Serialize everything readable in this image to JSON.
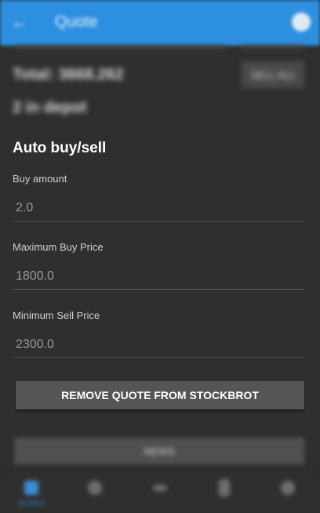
{
  "appbar": {
    "title": "Quote",
    "back_icon": "back-arrow-icon",
    "action_icon": "info-icon"
  },
  "summary": {
    "total": "Total: 3668.262",
    "sell_all_label": "SELL ALL",
    "depot": "2 in depot"
  },
  "auto": {
    "title": "Auto buy/sell",
    "fields": [
      {
        "label": "Buy amount",
        "value": "2.0"
      },
      {
        "label": "Maximum Buy Price",
        "value": "1800.0"
      },
      {
        "label": "Minimum Sell Price",
        "value": "2300.0"
      }
    ],
    "remove_label": "REMOVE QUOTE FROM STOCKBROT"
  },
  "news_label": "NEWS",
  "nav": {
    "items": [
      {
        "label": "Stockbrot",
        "icon": "home-icon",
        "active": true
      },
      {
        "label": "",
        "icon": "search-icon",
        "active": false
      },
      {
        "label": "",
        "icon": "swap-icon",
        "active": false
      },
      {
        "label": "",
        "icon": "document-icon",
        "active": false
      },
      {
        "label": "",
        "icon": "settings-icon",
        "active": false
      }
    ]
  },
  "colors": {
    "appbar": "#2d8fe0",
    "background": "#2f2f2f",
    "button": "#555555",
    "nav_active": "#3b8fd8"
  }
}
